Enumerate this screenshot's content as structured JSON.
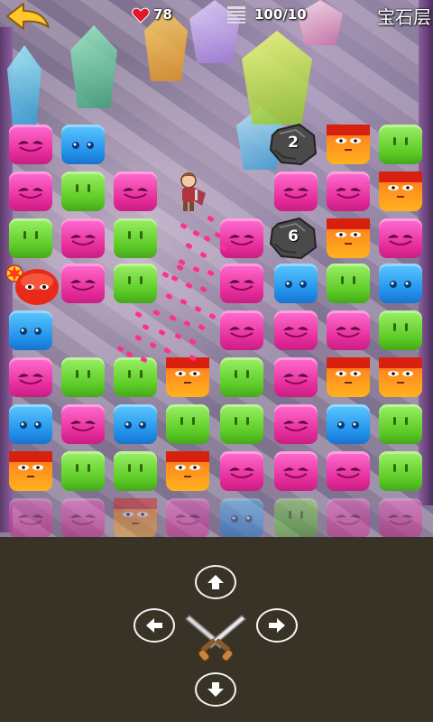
{
  "hud": {
    "life": "78",
    "steps": "100/10",
    "level_name": "宝石层"
  },
  "board": {
    "rows": [
      [
        "pink",
        "blue",
        "",
        "",
        "",
        "rock",
        "orange",
        "green"
      ],
      [
        "pink",
        "green",
        "pink",
        "",
        "",
        "pink",
        "pink",
        "orange"
      ],
      [
        "green",
        "pink",
        "green",
        "",
        "pink",
        "rock",
        "orange",
        "pink"
      ],
      [
        "bomb",
        "pink",
        "green",
        "",
        "pink",
        "blue",
        "green",
        "blue"
      ],
      [
        "blue",
        "",
        "",
        "",
        "pink",
        "pink",
        "pink",
        "green"
      ],
      [
        "pink",
        "green",
        "green",
        "orange",
        "green",
        "pink",
        "orange",
        "orange"
      ],
      [
        "blue",
        "pink",
        "blue",
        "green",
        "green",
        "pink",
        "blue",
        "green"
      ],
      [
        "orange",
        "green",
        "green",
        "orange",
        "pink",
        "pink",
        "pink",
        "green"
      ],
      [
        "pink",
        "pink",
        "orange",
        "pink",
        "blue",
        "green",
        "pink",
        "pink"
      ]
    ],
    "rocks": [
      {
        "row": 0,
        "col": 5,
        "count": "2"
      },
      {
        "row": 2,
        "col": 5,
        "count": "6"
      }
    ]
  },
  "controls": {
    "up": "up-arrow",
    "down": "down-arrow",
    "left": "left-arrow",
    "right": "right-arrow",
    "attack": "crossed-swords"
  },
  "colors": {
    "pink": "#e62c9c",
    "blue": "#2291ea",
    "green": "#5ccb26",
    "orange": "#ff8a1e",
    "controls_bg": "#393327"
  }
}
